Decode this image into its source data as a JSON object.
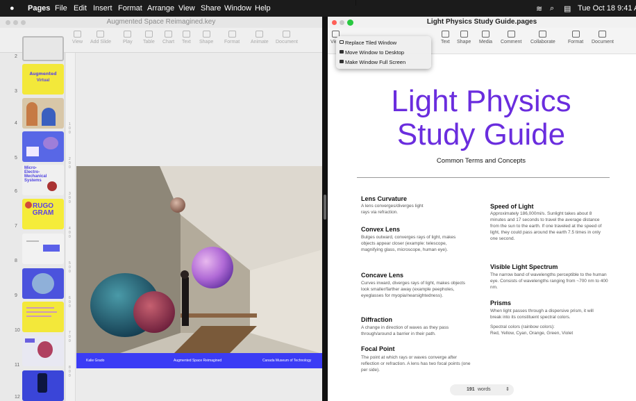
{
  "menubar": {
    "app": "Pages",
    "items": [
      "File",
      "Edit",
      "Insert",
      "Format",
      "Arrange",
      "View",
      "Share",
      "Window",
      "Help"
    ],
    "clock": "Tue Oct 18  9:41 AM"
  },
  "left_window": {
    "title": "Augmented Space Reimagined.key",
    "toolbar": [
      "View",
      "Add Slide",
      "Play",
      "Table",
      "Chart",
      "Text",
      "Shape",
      "Format",
      "Animate",
      "Document"
    ],
    "slide_numbers": [
      "2",
      "3",
      "4",
      "5",
      "6",
      "7",
      "8",
      "9",
      "10",
      "11",
      "12"
    ],
    "thumb_texts": {
      "slide3_line1": "Augmented",
      "slide3_line2": "Virtual",
      "slide6": "Micro-Electro-Mechanical Systems",
      "slide7": "RUGO GRAM"
    },
    "slide_footer": {
      "left": "Kalie Grado",
      "center": "Augmented Space Reimagined",
      "right": "Canada Museum of Technology"
    }
  },
  "right_window": {
    "title": "Light Physics Study Guide.pages",
    "toolbar": [
      "View",
      "Text",
      "Shape",
      "Media",
      "Comment",
      "Collaborate",
      "Format",
      "Document"
    ],
    "popup_menu": [
      "Replace Tiled Window",
      "Move Window to Desktop",
      "Make Window Full Screen"
    ],
    "doc": {
      "title_line1": "Light Physics",
      "title_line2": "Study Guide",
      "subtitle": "Common Terms and Concepts",
      "left_col": [
        {
          "heading": "Lens Curvature",
          "body": "A lens converges/diverges light rays via refraction."
        },
        {
          "heading": "Convex Lens",
          "body": "Bulges outward, converges rays of light, makes objects appear closer (example: telescope, magnifying glass, microscope, human eye)."
        },
        {
          "heading": "Concave Lens",
          "body": "Curves inward, diverges rays of light, makes objects look smaller/farther away (example peepholes, eyeglasses for myopia/nearsightedness)."
        },
        {
          "heading": "Diffraction",
          "body": "A change in direction of waves as they pass through/around a barrier in their path."
        },
        {
          "heading": "Focal Point",
          "body": "The point at which rays or waves converge after reflection or refraction. A lens has two focal points (one per side)."
        }
      ],
      "right_col": [
        {
          "heading": "Speed of Light",
          "body": "Approximately 186,000mi/s. Sunlight takes about 8 minutes and 17 seconds to travel the average distance from the sun to the earth. If one traveled at the speed of light, they could pass around the earth 7.5 times in only one second."
        },
        {
          "heading": "Visible Light Spectrum",
          "body": "The narrow band of wavelengths perceptible to the human eye. Consists of wavelengths ranging from ~700 nm to 400 nm."
        },
        {
          "heading": "Prisms",
          "body": "When light passes through a dispersive prism, it will break into its constituent spectral colors."
        }
      ],
      "spectral": "Spectral colors (rainbow colors):",
      "spectral_list": "Red, Yellow, Cyan, Orange, Green, Violet",
      "word_count": "191",
      "word_label": "words"
    }
  },
  "colors": {
    "accent_purple": "#6a2dde",
    "slide_blue": "#3b3cf5",
    "close_red": "#ff5f57",
    "zoom_green": "#28c840"
  }
}
